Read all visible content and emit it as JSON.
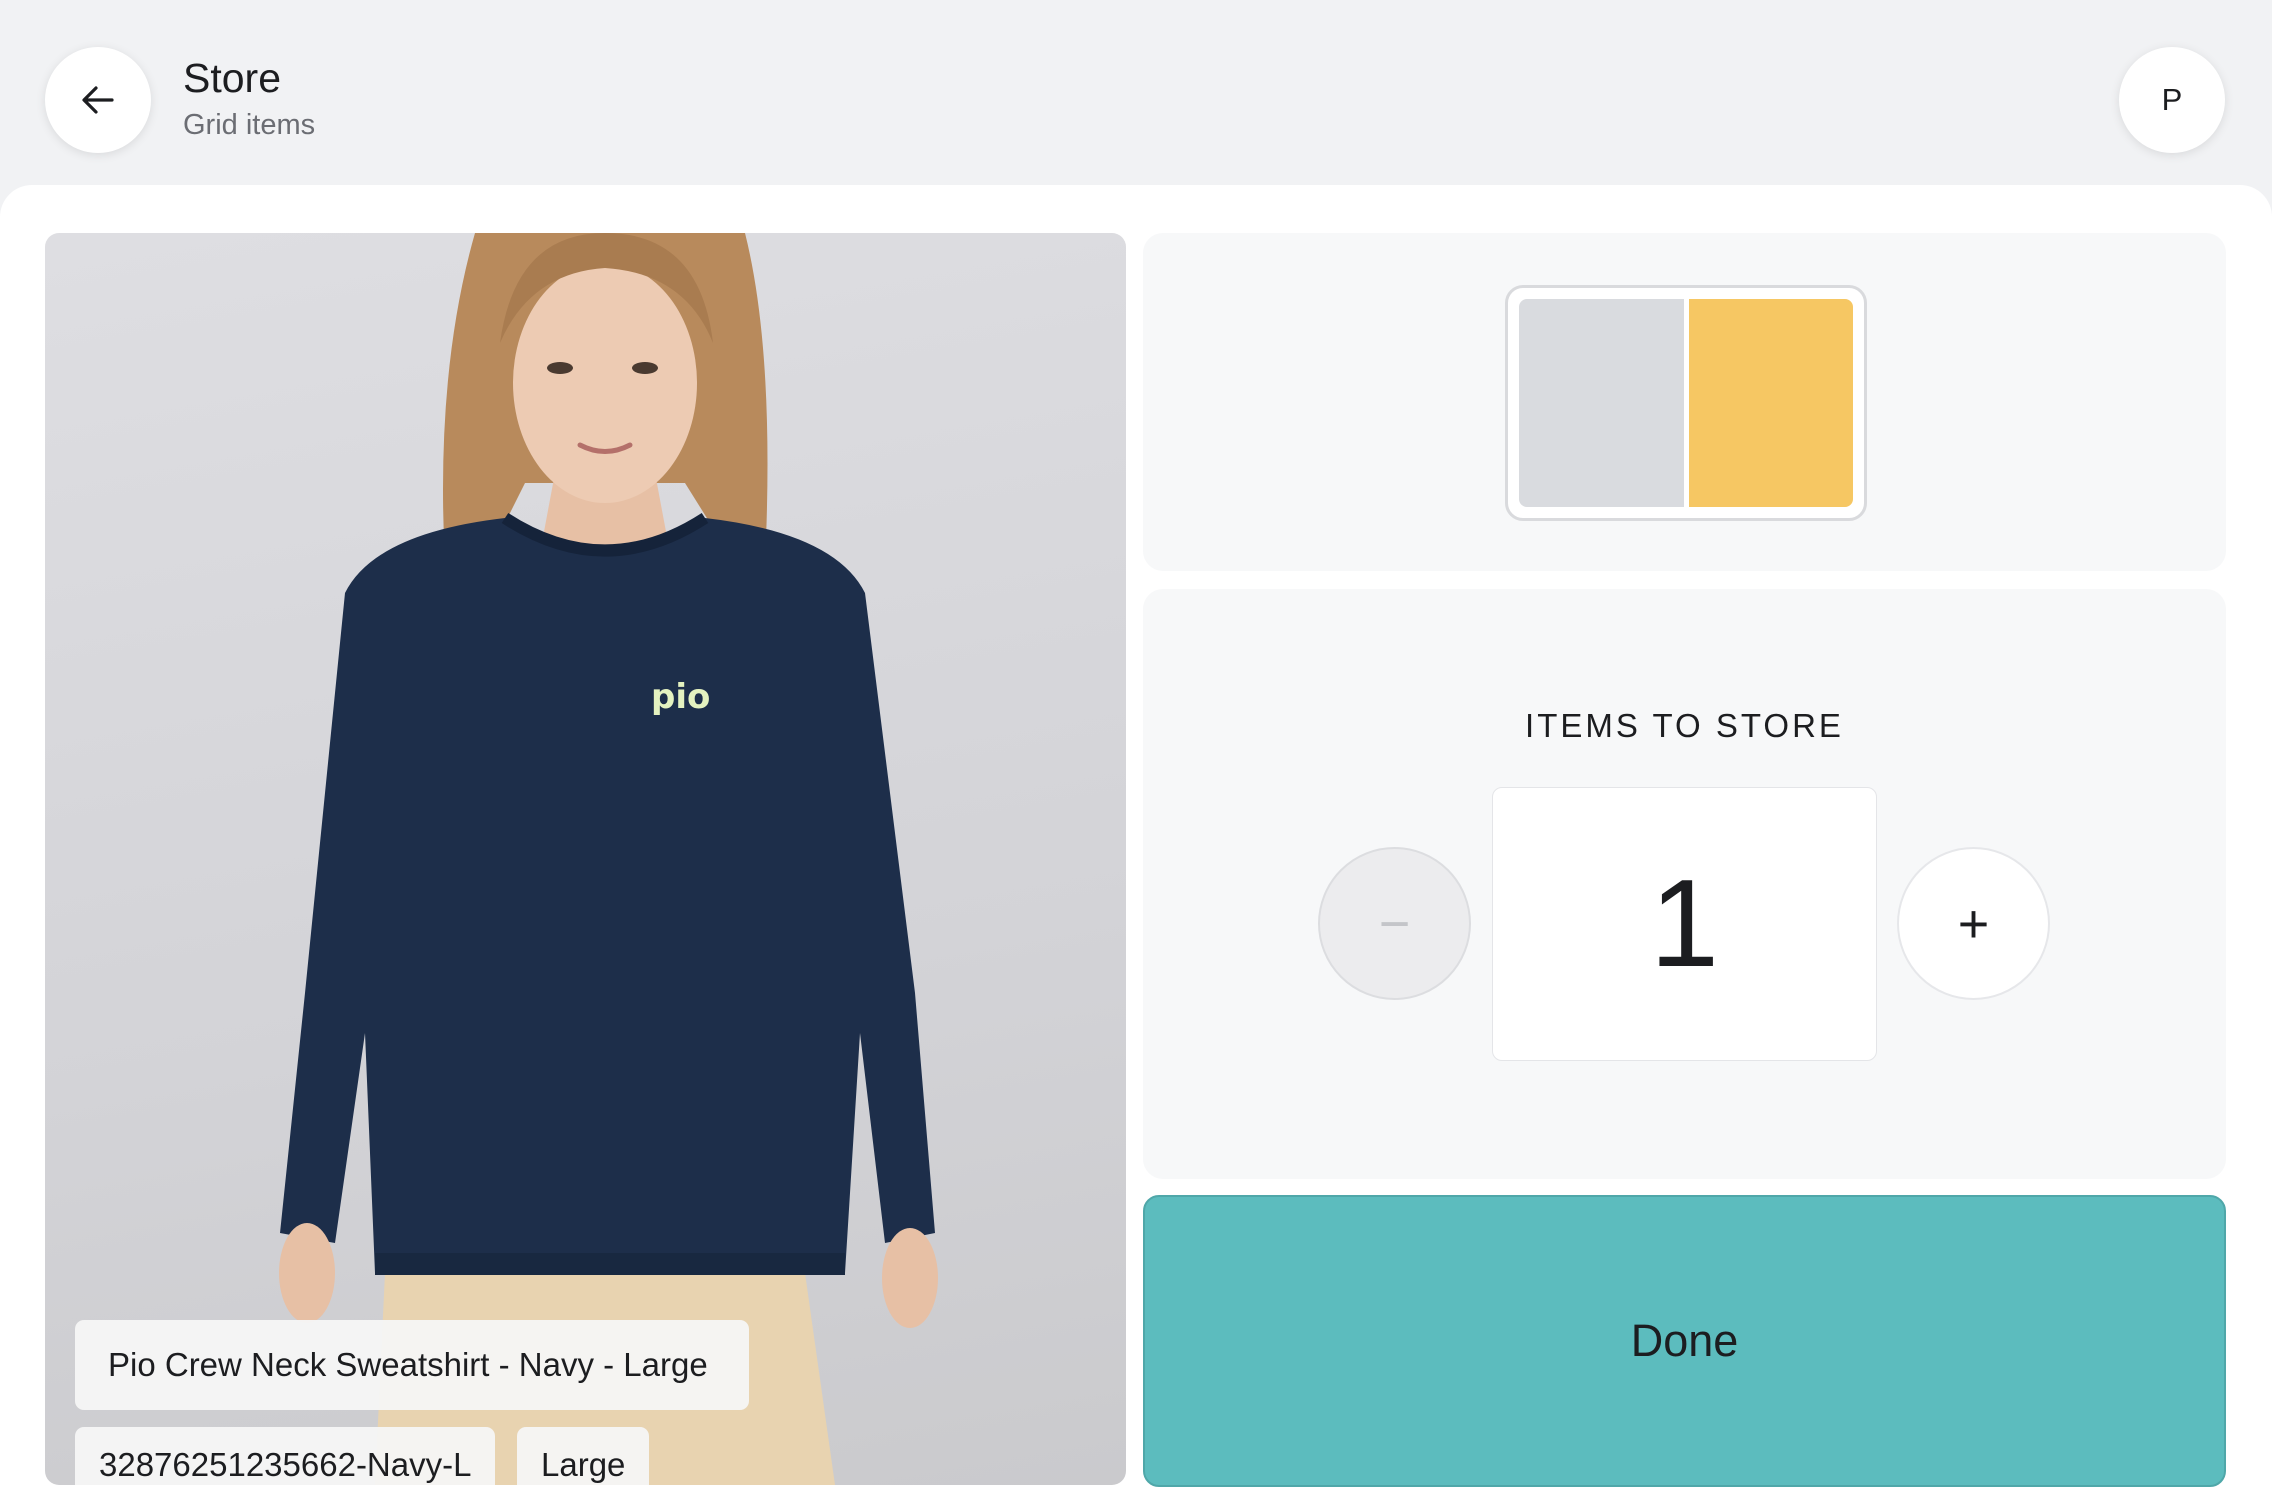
{
  "header": {
    "title": "Store",
    "subtitle": "Grid items",
    "back_icon": "arrow-left-icon",
    "avatar_initial": "P"
  },
  "product": {
    "name": "Pio Crew Neck Sweatshirt - Navy - Large",
    "sku": "32876251235662-Navy-L",
    "size": "Large",
    "logo_text": "pio"
  },
  "grid": {
    "cells": [
      {
        "state": "empty",
        "color": "#d9dbdf"
      },
      {
        "state": "selected",
        "color": "#f6c763"
      }
    ]
  },
  "quantity": {
    "label": "ITEMS TO STORE",
    "value": "1",
    "minus_label": "−",
    "plus_label": "+"
  },
  "actions": {
    "done_label": "Done"
  },
  "colors": {
    "accent": "#5cbcbe",
    "selected_cell": "#f6c763",
    "sweatshirt": "#1d2e4a"
  }
}
